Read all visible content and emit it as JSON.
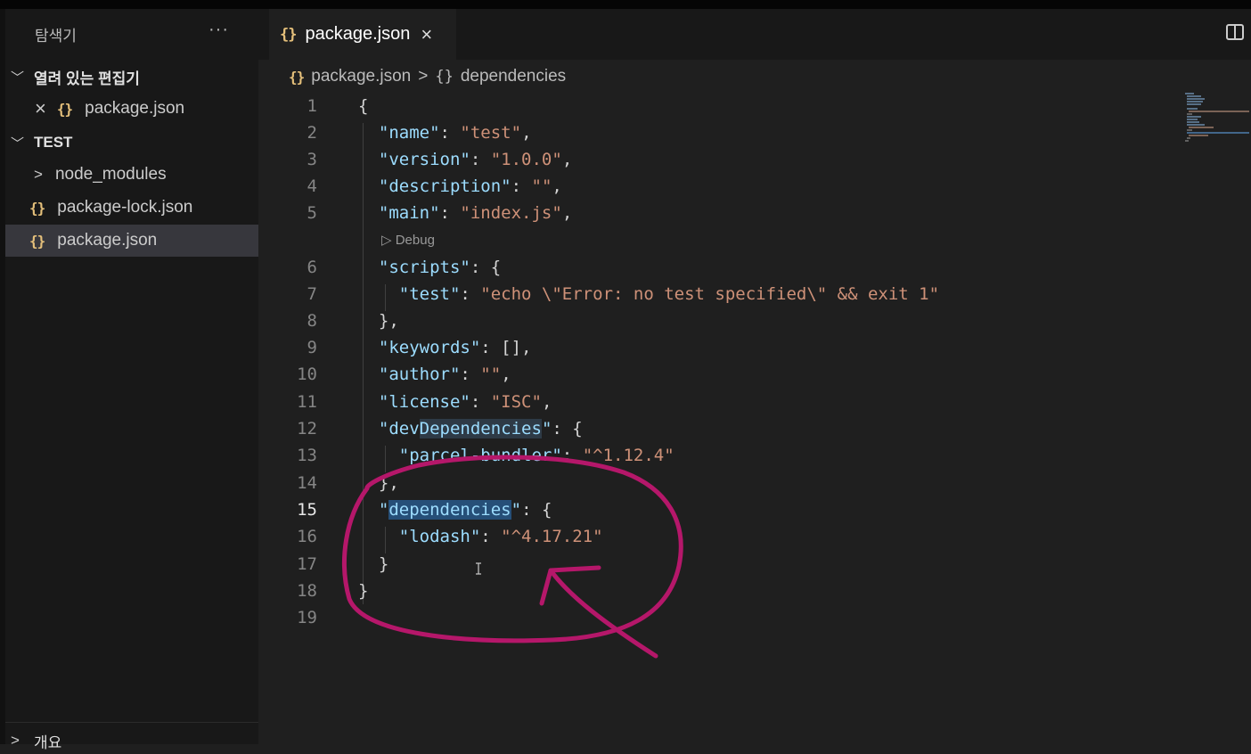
{
  "explorer": {
    "title": "탐색기",
    "more_label": "···",
    "open_editors": {
      "header": "열려 있는 편집기",
      "items": [
        {
          "close": "×",
          "icon": "{}",
          "label": "package.json"
        }
      ]
    },
    "project": {
      "header": "TEST",
      "items": [
        {
          "type": "folder",
          "chevron": ">",
          "label": "node_modules"
        },
        {
          "type": "file",
          "icon": "{}",
          "label": "package-lock.json"
        },
        {
          "type": "file",
          "icon": "{}",
          "label": "package.json",
          "selected": true
        }
      ]
    },
    "outline": {
      "header": "개요"
    }
  },
  "tab": {
    "icon": "{}",
    "label": "package.json",
    "close": "×"
  },
  "breadcrumb": [
    {
      "icon": "{}",
      "label": "package.json"
    },
    {
      "icon": "{}",
      "label": "dependencies"
    }
  ],
  "codelens": "▷ Debug",
  "line_numbers": [
    "1",
    "2",
    "3",
    "4",
    "5",
    "6",
    "7",
    "8",
    "9",
    "10",
    "11",
    "12",
    "13",
    "14",
    "15",
    "16",
    "17",
    "18",
    "19"
  ],
  "current_line": "15",
  "code": {
    "l1": "{",
    "l2_key": "\"name\"",
    "l2_val": "\"test\"",
    "l3_key": "\"version\"",
    "l3_val": "\"1.0.0\"",
    "l4_key": "\"description\"",
    "l4_val": "\"\"",
    "l5_key": "\"main\"",
    "l5_val": "\"index.js\"",
    "l6_key": "\"scripts\"",
    "l7_key": "\"test\"",
    "l7_val": "\"echo \\\"Error: no test specified\\\" && exit 1\"",
    "l8": "},",
    "l9_key": "\"keywords\"",
    "l9_val": "[],",
    "l10_key": "\"author\"",
    "l10_val": "\"\"",
    "l11_key": "\"license\"",
    "l11_val": "\"ISC\"",
    "l12_key_a": "\"dev",
    "l12_key_b": "Dependencies",
    "l12_key_c": "\"",
    "l13_key": "\"parcel-bundler\"",
    "l13_val": "\"^1.12.4\"",
    "l14": "},",
    "l15_q1": "\"",
    "l15_word": "dependencies",
    "l15_q2": "\"",
    "l16_key": "\"lodash\"",
    "l16_val": "\"^4.17.21\"",
    "l17": "}",
    "l18": "}"
  },
  "colors": {
    "annotation": "#b5176a",
    "key": "#9cdcfe",
    "string": "#ce9178",
    "json_icon": "#e5c07b"
  }
}
